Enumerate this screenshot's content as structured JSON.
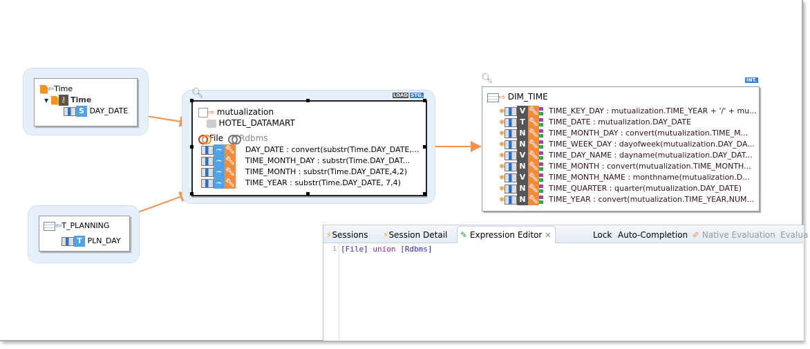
{
  "source_time": {
    "file": "Time",
    "record": "Time",
    "columns": [
      {
        "name": "DAY_DATE",
        "type": "S"
      }
    ]
  },
  "source_planning": {
    "table": "T_PLANNING",
    "columns": [
      {
        "name": "PLN_DAY",
        "type": "T"
      }
    ]
  },
  "mutualization": {
    "name": "mutualization",
    "model": "HOTEL_DATAMART",
    "datasets": [
      "File",
      "Rdbms"
    ],
    "badges": [
      "LOAD",
      "STG."
    ],
    "rows": [
      "DAY_DATE : convert(substr(Time.DAY_DATE,...",
      "TIME_MONTH_DAY : substr(Time.DAY_DAT...",
      "TIME_MONTH : substr(Time.DAY_DATE,4,2)",
      "TIME_YEAR : substr(Time.DAY_DATE, 7,4)"
    ]
  },
  "target": {
    "name": "DIM_TIME",
    "badge": "INT.",
    "rows": [
      {
        "type": "V",
        "text": "TIME_KEY_DAY : mutualization.TIME_YEAR + '/' + mu..."
      },
      {
        "type": "T",
        "text": "TIME_DATE : mutualization.DAY_DATE"
      },
      {
        "type": "N",
        "text": "TIME_MONTH_DAY : convert(mutualization.TIME_M..."
      },
      {
        "type": "N",
        "text": "TIME_WEEK_DAY : dayofweek(mutualization.DAY_DA..."
      },
      {
        "type": "V",
        "text": "TIME_DAY_NAME : dayname(mutualization.DAY_DAT..."
      },
      {
        "type": "N",
        "text": "TIME_MONTH : convert(mutualization.TIME_MONTH..."
      },
      {
        "type": "V",
        "text": "TIME_MONTH_NAME : monthname(mutualization.D..."
      },
      {
        "type": "N",
        "text": "TIME_QUARTER : quarter(mutualization.DAY_DATE)"
      },
      {
        "type": "N",
        "text": "TIME_YEAR : convert(mutualization.TIME_YEAR,NUM..."
      }
    ]
  },
  "panel": {
    "tabs": [
      "Sessions",
      "Session Detail",
      "Expression Editor"
    ],
    "actions": [
      "Lock",
      "Auto-Completion",
      "Native Evaluation",
      "Evalua"
    ],
    "line_number": "1",
    "expression": {
      "a": "[File]",
      "op": "union",
      "b": "[Rdbms]"
    }
  },
  "colors": {
    "halo": "#e6f0fb",
    "link": "#f5924a",
    "keyword": "#9a1a9a",
    "bracket": "#2a2ad0"
  }
}
